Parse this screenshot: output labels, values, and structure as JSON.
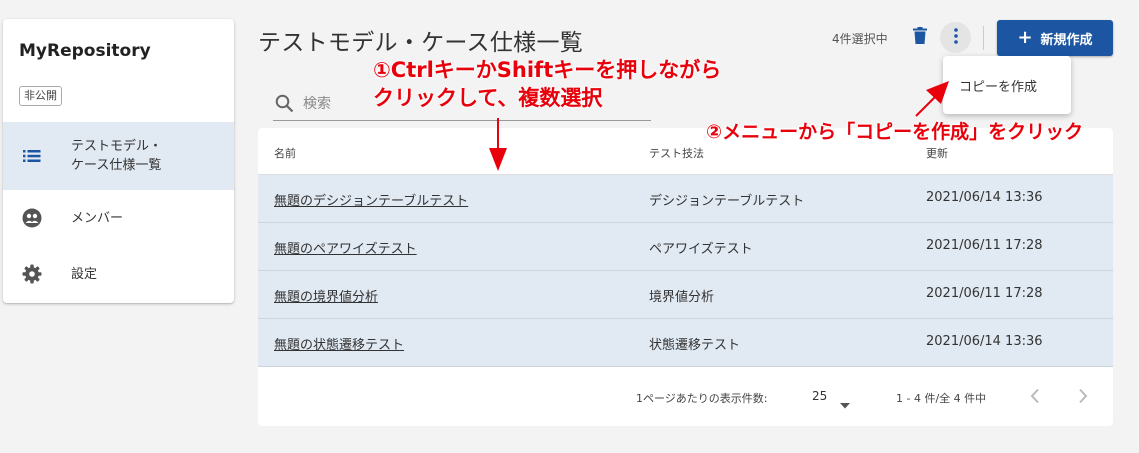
{
  "sidebar": {
    "repo_name": "MyRepository",
    "visibility": "非公開",
    "items": [
      {
        "label": "テストモデル・\nケース仕様一覧",
        "icon": "list-icon",
        "active": true
      },
      {
        "label": "メンバー",
        "icon": "members-icon",
        "active": false
      },
      {
        "label": "設定",
        "icon": "gear-icon",
        "active": false
      }
    ]
  },
  "header": {
    "title": "テストモデル・ケース仕様一覧",
    "selection_count": "4件選択中",
    "new_button": "新規作成"
  },
  "menu": {
    "copy_label": "コピーを作成"
  },
  "search": {
    "placeholder": "検索"
  },
  "table": {
    "headers": [
      "名前",
      "テスト技法",
      "更新"
    ],
    "rows": [
      {
        "name": "無題のデシジョンテーブルテスト",
        "technique": "デシジョンテーブルテスト",
        "updated": "2021/06/14 13:36"
      },
      {
        "name": "無題のペアワイズテスト",
        "technique": "ペアワイズテスト",
        "updated": "2021/06/11 17:28"
      },
      {
        "name": "無題の境界値分析",
        "technique": "境界値分析",
        "updated": "2021/06/11 17:28"
      },
      {
        "name": "無題の状態遷移テスト",
        "technique": "状態遷移テスト",
        "updated": "2021/06/14 13:36"
      }
    ]
  },
  "pagination": {
    "rows_per_page_label": "1ページあたりの表示件数:",
    "rows_per_page": "25",
    "range": "1 - 4 件/全 4 件中"
  },
  "annotations": {
    "step1_line1": "①CtrlキーかShiftキーを押しながら",
    "step1_line2": "クリックして、複数選択",
    "step2": "②メニューから「コピーを作成」をクリック"
  },
  "colors": {
    "primary": "#1c56a3",
    "selected_row": "#e1e9f3",
    "annotation": "#e8000b"
  }
}
